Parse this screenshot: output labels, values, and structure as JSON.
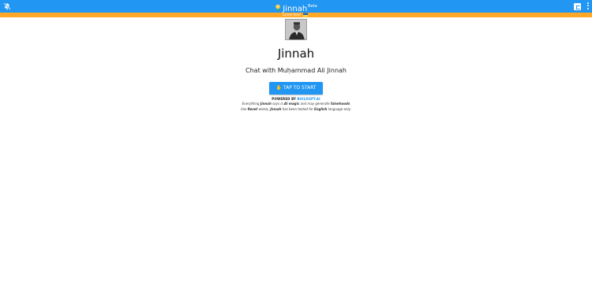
{
  "header": {
    "app_title": "Jinnah",
    "beta_label": "Beta",
    "left_icon": "mute-icon",
    "right_square_icon": "copyright-icon",
    "menu_icon": "more-vert-icon",
    "bar_color": "#2196f3"
  },
  "banner": {
    "tagline": "Lorem fond",
    "flag_icon": "flag-icon",
    "color": "#ffa726"
  },
  "profile": {
    "name": "Jinnah",
    "subtitle": "Chat with Muḥammad Ali Jinnah"
  },
  "start_button": {
    "label": "TAP TO START",
    "icon": "hand-icon"
  },
  "powered": {
    "prefix": "POWERED BY ",
    "link": "BUILDGPT.AI"
  },
  "disclaimer": {
    "line1_a": "Everything ",
    "line1_b": "Jinnah",
    "line1_c": " says is ",
    "line1_d": "AI magic",
    "line1_e": " and may generate ",
    "line1_f": "falsehoods",
    "line2_a": "Use ",
    "line2_b": "Reset",
    "line2_c": " wisely. ",
    "line2_d": "Jinnah",
    "line2_e": " has been tested for ",
    "line2_f": "English",
    "line2_g": " language only."
  }
}
